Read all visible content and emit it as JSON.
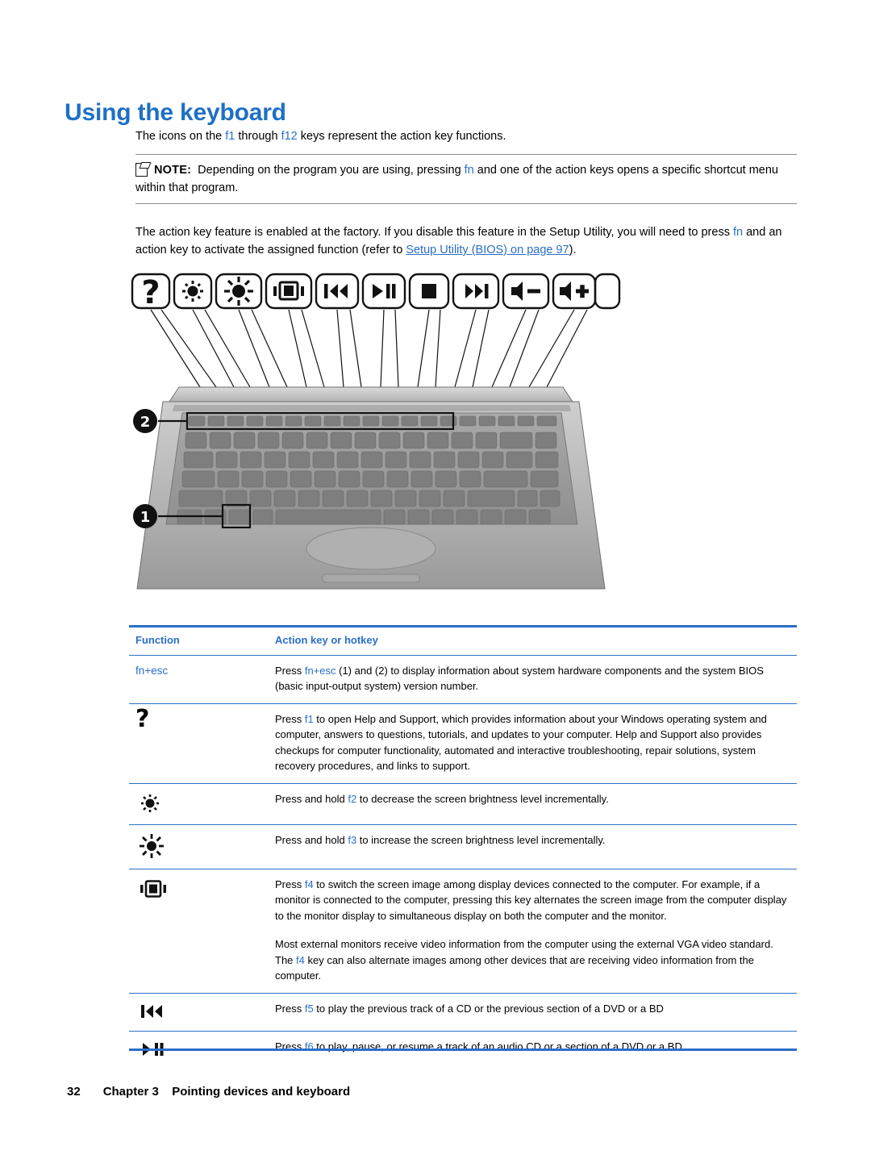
{
  "page": {
    "title": "Using the keyboard",
    "intro": {
      "pre": "The icons on the ",
      "k1": "f1",
      "mid": " through ",
      "k2": "f12",
      "post": " keys represent the action key functions."
    },
    "note": {
      "label": "NOTE:",
      "text_pre": "Depending on the program you are using, pressing ",
      "key": "fn",
      "text_post": " and one of the action keys opens a specific shortcut menu within that program."
    },
    "para2": {
      "pre": "The action key feature is enabled at the factory. If you disable this feature in the Setup Utility, you will need to press ",
      "key": "fn",
      "mid": " and an action key to activate the assigned function (refer to ",
      "link": "Setup Utility (BIOS) on page 97",
      "post": ")."
    },
    "illustration": {
      "callout_1": "1",
      "callout_2": "2",
      "alt": "Top view of notebook keyboard with action keys callouts"
    }
  },
  "table": {
    "headers": [
      "Function",
      "Action key or hotkey"
    ],
    "rows": [
      {
        "icon": "fn-esc-text",
        "function_label": "fn+esc",
        "lines": [
          {
            "pre": "Press ",
            "key": "fn+esc",
            "post": " (1) and (2) to display information about system hardware components and the system BIOS (basic input-output system) version number."
          }
        ]
      },
      {
        "icon": "question-mark-icon",
        "function_label": "",
        "lines": [
          {
            "pre": "Press ",
            "key": "f1",
            "post": " to open Help and Support, which provides information about your Windows operating system and computer, answers to questions, tutorials, and updates to your computer. Help and Support also provides checkups for computer functionality, automated and interactive troubleshooting, repair solutions, system recovery procedures, and links to support."
          }
        ]
      },
      {
        "icon": "brightness-down-icon",
        "function_label": "",
        "lines": [
          {
            "pre": "Press and hold ",
            "key": "f2",
            "post": " to decrease the screen brightness level incrementally."
          }
        ]
      },
      {
        "icon": "brightness-up-icon",
        "function_label": "",
        "lines": [
          {
            "pre": "Press and hold ",
            "key": "f3",
            "post": " to increase the screen brightness level incrementally."
          }
        ]
      },
      {
        "icon": "display-switch-icon",
        "function_label": "",
        "lines": [
          {
            "pre": "Press ",
            "key": "f4",
            "post": " to switch the screen image among display devices connected to the computer. For example, if a monitor is connected to the computer, pressing this key alternates the screen image from the computer display to the monitor display to simultaneous display on both the computer and the monitor."
          },
          {
            "pre": "Most external monitors receive video information from the computer using the external VGA video standard. The ",
            "key": "f4",
            "post": " key can also alternate images among other devices that are receiving video information from the computer."
          }
        ]
      },
      {
        "icon": "previous-track-icon",
        "function_label": "",
        "lines": [
          {
            "pre": "Press ",
            "key": "f5",
            "post": " to play the previous track of a CD or the previous section of a DVD or a BD"
          }
        ]
      },
      {
        "icon": "play-pause-icon",
        "function_label": "",
        "lines": [
          {
            "pre": "Press ",
            "key": "f6",
            "post": " to play, pause, or resume a track of an audio CD or a section of a DVD or a BD."
          }
        ]
      }
    ]
  },
  "footer": {
    "page_number": "32",
    "chapter": "Chapter 3",
    "chapter_title": "Pointing devices and keyboard"
  },
  "colors": {
    "accent": "#2a6fc9",
    "heading": "#1f6fc4",
    "text": "#000000"
  }
}
